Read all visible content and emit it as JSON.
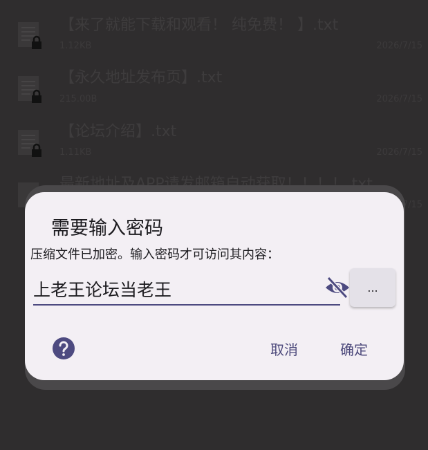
{
  "files": [
    {
      "name": "【来了就能下载和观看！ 纯免费！ 】.txt",
      "size": "1.12KB",
      "date": "2026/7/15"
    },
    {
      "name": "【永久地址发布页】.txt",
      "size": "215.00B",
      "date": "2026/7/15"
    },
    {
      "name": "【论坛介绍】.txt",
      "size": "1.11KB",
      "date": "2026/7/15"
    },
    {
      "name": "最新地址及APP请发邮箱自动获取！！！！.txt",
      "size": "",
      "date": "2026/7/15"
    }
  ],
  "dialog": {
    "title": "需要输入密码",
    "message": "压缩文件已加密。输入密码才可访问其内容：",
    "password_value": "上老王论坛当老王",
    "browse_label": "...",
    "cancel_label": "取消",
    "ok_label": "确定"
  },
  "icons": {
    "file": "text-file-icon",
    "lock": "lock-icon",
    "visibility": "eye-off-icon",
    "help": "help-circle-icon"
  },
  "colors": {
    "accent": "#4d4a80",
    "dialog_bg": "#f3eff4",
    "screen_bg": "#2f2d2e"
  }
}
